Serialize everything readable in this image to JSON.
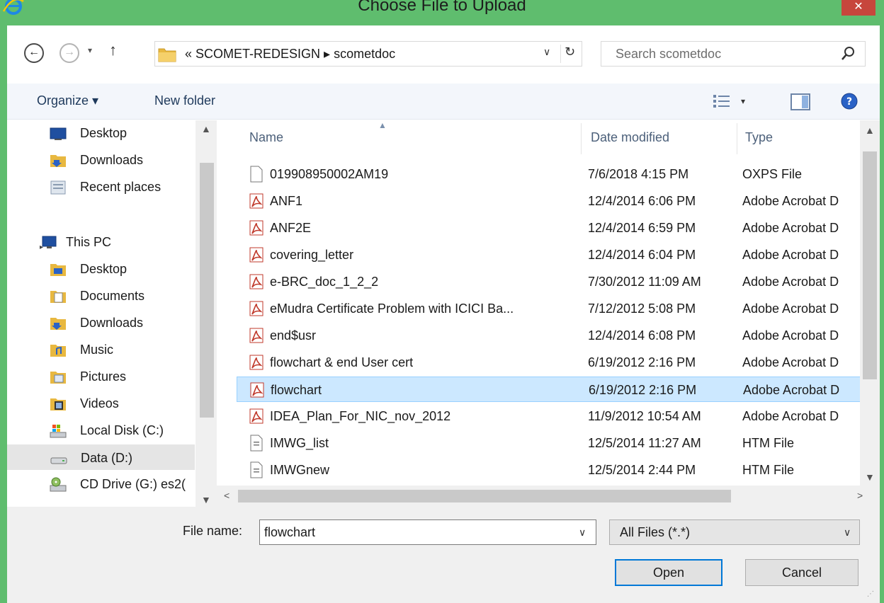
{
  "window": {
    "title": "Choose File to Upload",
    "close_label": "✕",
    "accent_color": "#5fbd6e",
    "icons": [
      "ie-icon",
      "close-icon"
    ]
  },
  "navigation": {
    "back_label": "←",
    "forward_label": "→",
    "recent_label": "▾",
    "up_label": "↑",
    "breadcrumb": "« SCOMET-REDESIGN ▸ scometdoc",
    "address_dropdown": "∨",
    "refresh_label": "↻",
    "search_placeholder": "Search scometdoc"
  },
  "toolbar": {
    "organize_label": "Organize ▾",
    "new_folder_label": "New folder",
    "views_arrow": "▾",
    "icons": [
      "views-icon",
      "preview-pane-icon",
      "help-icon"
    ]
  },
  "nav_pane": {
    "items": [
      {
        "label": "Desktop",
        "icon": "desktop-icon"
      },
      {
        "label": "Downloads",
        "icon": "downloads-folder-icon"
      },
      {
        "label": "Recent places",
        "icon": "recent-places-icon"
      },
      {
        "label": "This PC",
        "icon": "this-pc-icon"
      },
      {
        "label": "Desktop",
        "icon": "desktop-folder-icon"
      },
      {
        "label": "Documents",
        "icon": "documents-folder-icon"
      },
      {
        "label": "Downloads",
        "icon": "downloads-folder-icon"
      },
      {
        "label": "Music",
        "icon": "music-folder-icon"
      },
      {
        "label": "Pictures",
        "icon": "pictures-folder-icon"
      },
      {
        "label": "Videos",
        "icon": "videos-folder-icon"
      },
      {
        "label": "Local Disk (C:)",
        "icon": "local-disk-icon"
      },
      {
        "label": "Data (D:)",
        "icon": "drive-icon",
        "selected": true
      },
      {
        "label": "CD Drive (G:) es2(",
        "icon": "cd-drive-icon"
      }
    ]
  },
  "file_list": {
    "columns": [
      "Name",
      "Date modified",
      "Type"
    ],
    "sort_indicator": "▲",
    "rows": [
      {
        "name": "019908950002AM19",
        "date": "7/6/2018 4:15 PM",
        "type": "OXPS File",
        "icon": "blank-file-icon"
      },
      {
        "name": "ANF1",
        "date": "12/4/2014 6:06 PM",
        "type": "Adobe Acrobat D",
        "icon": "pdf-icon"
      },
      {
        "name": "ANF2E",
        "date": "12/4/2014 6:59 PM",
        "type": "Adobe Acrobat D",
        "icon": "pdf-icon"
      },
      {
        "name": "covering_letter",
        "date": "12/4/2014 6:04 PM",
        "type": "Adobe Acrobat D",
        "icon": "pdf-icon"
      },
      {
        "name": "e-BRC_doc_1_2_2",
        "date": "7/30/2012 11:09 AM",
        "type": "Adobe Acrobat D",
        "icon": "pdf-icon"
      },
      {
        "name": "eMudra Certificate Problem with ICICI Ba...",
        "date": "7/12/2012 5:08 PM",
        "type": "Adobe Acrobat D",
        "icon": "pdf-icon"
      },
      {
        "name": "end$usr",
        "date": "12/4/2014 6:08 PM",
        "type": "Adobe Acrobat D",
        "icon": "pdf-icon"
      },
      {
        "name": "flowchart & end User cert",
        "date": "6/19/2012 2:16 PM",
        "type": "Adobe Acrobat D",
        "icon": "pdf-icon"
      },
      {
        "name": "flowchart",
        "date": "6/19/2012 2:16 PM",
        "type": "Adobe Acrobat D",
        "icon": "pdf-icon",
        "selected": true
      },
      {
        "name": "IDEA_Plan_For_NIC_nov_2012",
        "date": "11/9/2012 10:54 AM",
        "type": "Adobe Acrobat D",
        "icon": "pdf-icon"
      },
      {
        "name": "IMWG_list",
        "date": "12/5/2014 11:27 AM",
        "type": "HTM File",
        "icon": "htm-file-icon"
      },
      {
        "name": "IMWGnew",
        "date": "12/5/2014 2:44 PM",
        "type": "HTM File",
        "icon": "htm-file-icon"
      }
    ]
  },
  "scrollbars": {
    "up": "▲",
    "down": "▼",
    "left": "<",
    "right": ">"
  },
  "bottom": {
    "file_name_label": "File name:",
    "file_name_value": "flowchart",
    "file_name_dropdown": "∨",
    "filter_value": "All Files (*.*)",
    "filter_dropdown": "∨",
    "open_label": "Open",
    "cancel_label": "Cancel",
    "grip": "⋰"
  }
}
